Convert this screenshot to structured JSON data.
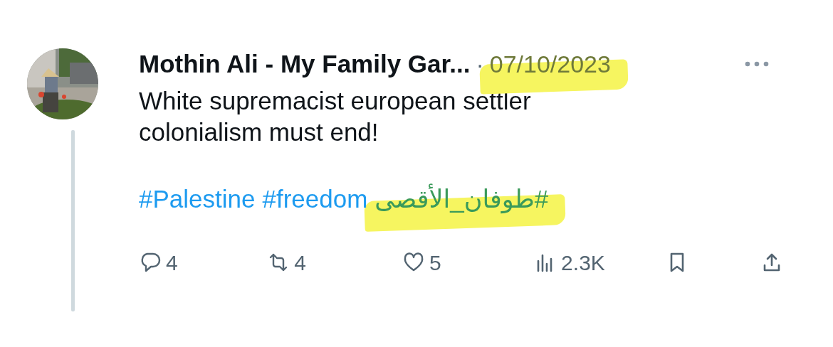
{
  "tweet": {
    "author": "Mothin Ali - My Family Gar...",
    "separator": "·",
    "date": "07/10/2023",
    "date_highlighted": true,
    "text_lines": [
      "White supremacist european settler",
      "colonialism must end!"
    ],
    "hashtags": [
      {
        "text": "#Palestine",
        "highlighted": false
      },
      {
        "text": "#freedom",
        "highlighted": false
      },
      {
        "text": "#طوفان_الأقصى",
        "highlighted": true
      }
    ],
    "actions": [
      {
        "kind": "reply",
        "count": "4"
      },
      {
        "kind": "repost",
        "count": "4"
      },
      {
        "kind": "like",
        "count": "5"
      },
      {
        "kind": "views",
        "count": "2.3K"
      },
      {
        "kind": "bookmark"
      },
      {
        "kind": "share"
      }
    ]
  }
}
